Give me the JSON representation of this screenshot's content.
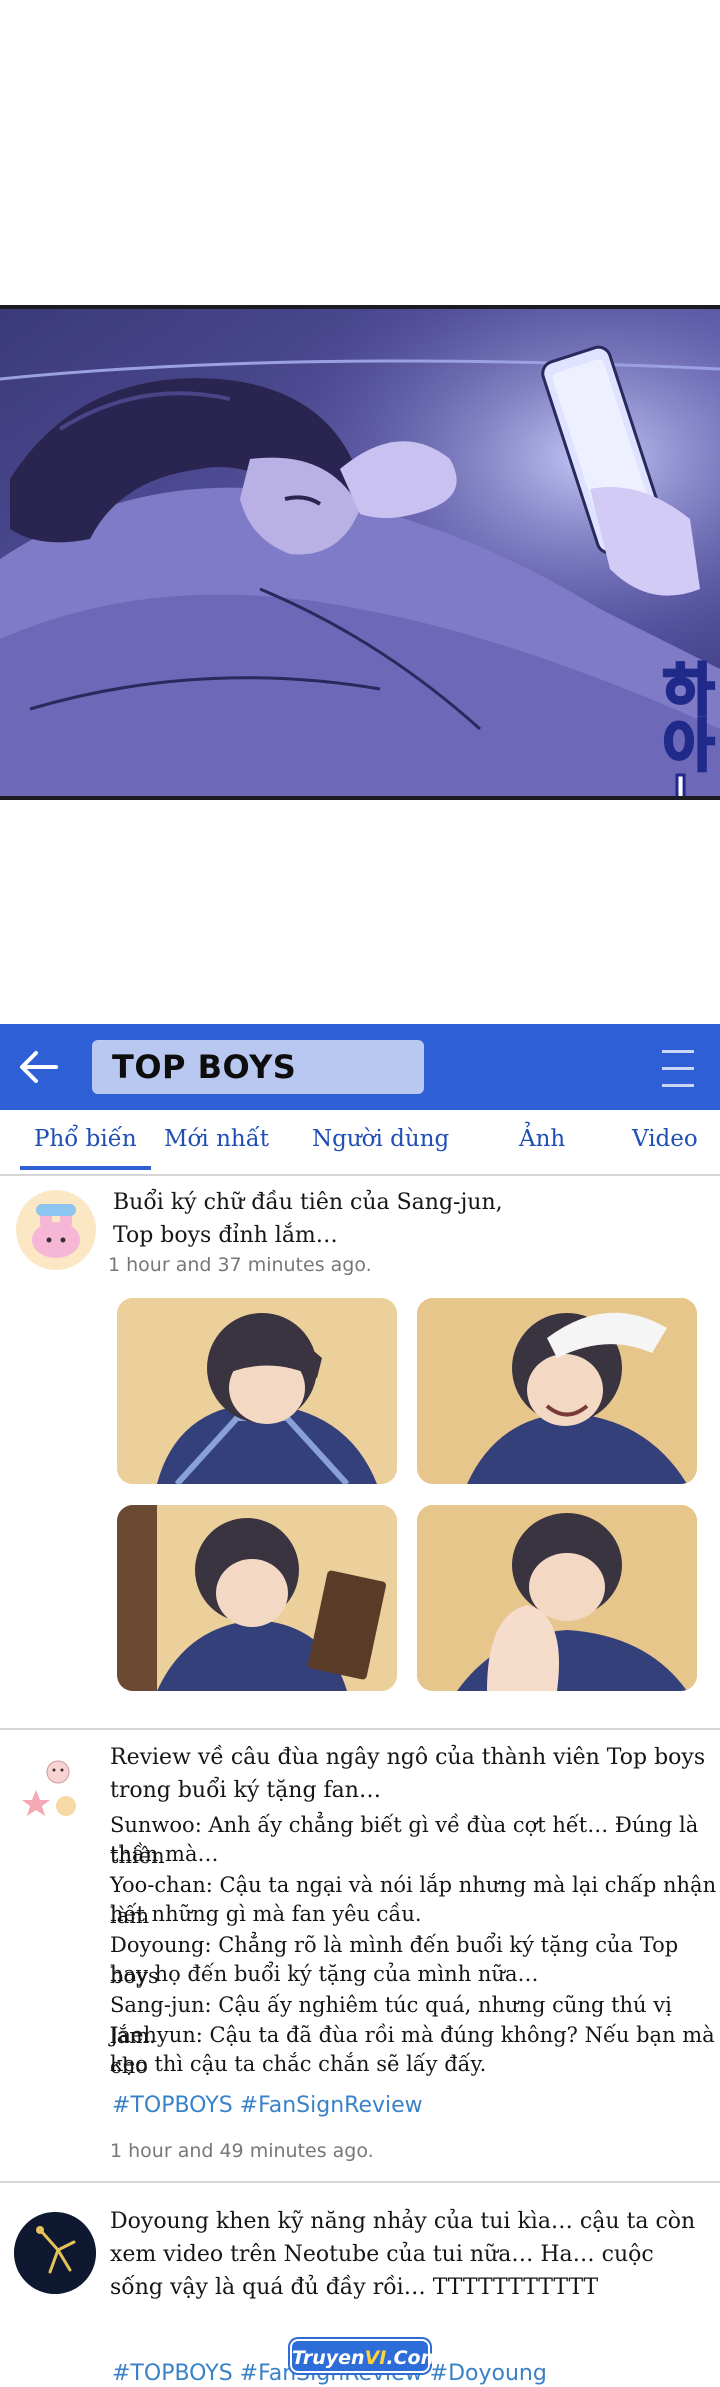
{
  "comic": {
    "sfx_text": "하아—"
  },
  "header": {
    "title": "TOP BOYS"
  },
  "tabs": [
    {
      "label": "Phổ biến"
    },
    {
      "label": "Mới nhất"
    },
    {
      "label": "Người dùng"
    },
    {
      "label": "Ảnh"
    },
    {
      "label": "Video"
    }
  ],
  "posts": [
    {
      "title_line1": "Buổi ký chữ đầu tiên của Sang-jun,",
      "title_line2": "Top boys đỉnh lắm…",
      "time": "1 hour and 37 minutes ago."
    },
    {
      "lines": [
        "Review về câu đùa ngây ngô của thành viên Top boys",
        "trong buổi ký tặng fan…",
        "Sunwoo: Anh ấy chẳng biết gì về đùa cợt hết… Đúng là thiên",
        "thần mà…",
        "Yoo-chan: Cậu ta ngại và nói lắp nhưng mà lại chấp nhận làm",
        "hết những gì mà fan yêu cầu.",
        "Doyoung: Chẳng rõ là mình đến buổi ký tặng của Top boys",
        "hay họ đến buổi ký tặng của mình nữa…",
        "Sang-jun: Cậu ấy nghiêm túc quá, nhưng cũng thú vị lắm.",
        "Jaehyun: Cậu ta đã đùa rồi mà đúng không? Nếu bạn mà cho",
        "kẹo thì cậu ta chắc chắn sẽ lấy đấy."
      ],
      "hashtags": "#TOPBOYS #FanSignReview",
      "time": "1 hour and 49 minutes ago."
    },
    {
      "lines": [
        "Doyoung khen kỹ năng nhảy của tui kìa… cậu ta còn",
        "xem video trên Neotube của tui nữa… Ha… cuộc",
        "sống vậy là quá đủ đầy rồi… TTTTTTTTTTT"
      ],
      "hashtags": "#TOPBOYS #FanSignReview #Doyoung"
    }
  ],
  "watermark": {
    "prefix": "Truyen",
    "accent": "VI",
    "suffix": ".Com"
  },
  "colors": {
    "header_blue": "#2e5fd4",
    "search_bg": "#b9c8f1",
    "tab_text": "#1f4fb6",
    "hashtag": "#3a82c8"
  },
  "icons": {
    "back": "back-arrow-icon",
    "menu": "menu-icon"
  }
}
